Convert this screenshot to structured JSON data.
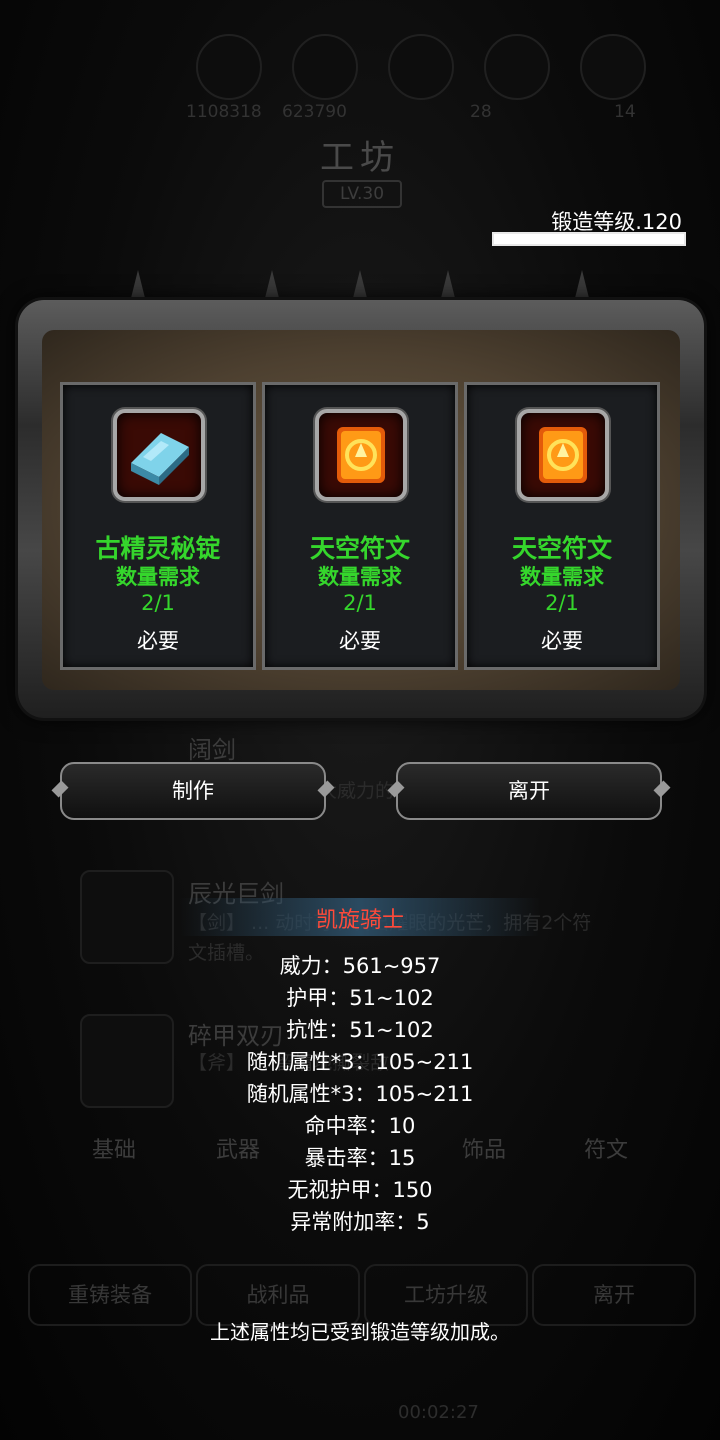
{
  "background": {
    "title": "工坊",
    "level": "LV.30",
    "resources": [
      "1108318",
      "623790",
      "28",
      "14"
    ],
    "items": [
      {
        "name": "阔剑",
        "desc": "大威力的"
      },
      {
        "name": "辰光巨剑",
        "desc": "【剑】 ... 动时可以发出耀眼的光芒，拥有2个符文插槽。"
      },
      {
        "name": "碎甲双刃",
        "desc": "【斧】 ... 留情地撕裂敌"
      }
    ],
    "tabs": [
      "基础",
      "武器",
      "饰品",
      "符文"
    ],
    "bottom_buttons": [
      "重铸装备",
      "战利品",
      "工坊升级",
      "离开"
    ],
    "timer": "00:02:27"
  },
  "forge": {
    "label": "锻造等级.120",
    "progress": 1.0
  },
  "materials": [
    {
      "name": "古精灵秘锭",
      "icon": "ingot-icon",
      "req_label": "数量需求",
      "count": "2/1",
      "need": "必要"
    },
    {
      "name": "天空符文",
      "icon": "rune-icon",
      "req_label": "数量需求",
      "count": "2/1",
      "need": "必要"
    },
    {
      "name": "天空符文",
      "icon": "rune-icon",
      "req_label": "数量需求",
      "count": "2/1",
      "need": "必要"
    }
  ],
  "actions": {
    "craft": "制作",
    "leave": "离开"
  },
  "tooltip": {
    "title": "凯旋骑士",
    "stats": [
      "威力：561~957",
      "护甲：51~102",
      "抗性：51~102",
      "随机属性*3：105~211",
      "随机属性*3：105~211",
      "命中率：10",
      "暴击率：15",
      "无视护甲：150",
      "异常附加率：5"
    ],
    "note": "上述属性均已受到锻造等级加成。"
  },
  "colors": {
    "green": "#35d62c",
    "title_red": "#ff4a3a"
  }
}
